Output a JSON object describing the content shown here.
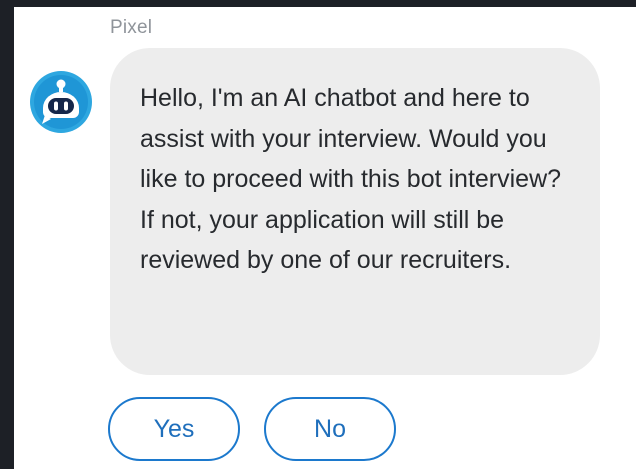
{
  "message": {
    "sender": "Pixel",
    "avatar_icon": "robot-icon",
    "text": "Hello, I'm an AI chatbot and here to assist with your interview. Would you like to proceed with this bot interview? If not, your application will still be reviewed by one of our recruiters."
  },
  "quick_replies": [
    {
      "label": "Yes"
    },
    {
      "label": "No"
    }
  ],
  "colors": {
    "page_background": "#1d2026",
    "panel_background": "#ffffff",
    "bubble_background": "#ededed",
    "accent": "#1c79cd",
    "sender_text": "#8f949a",
    "message_text": "#272a2e"
  }
}
